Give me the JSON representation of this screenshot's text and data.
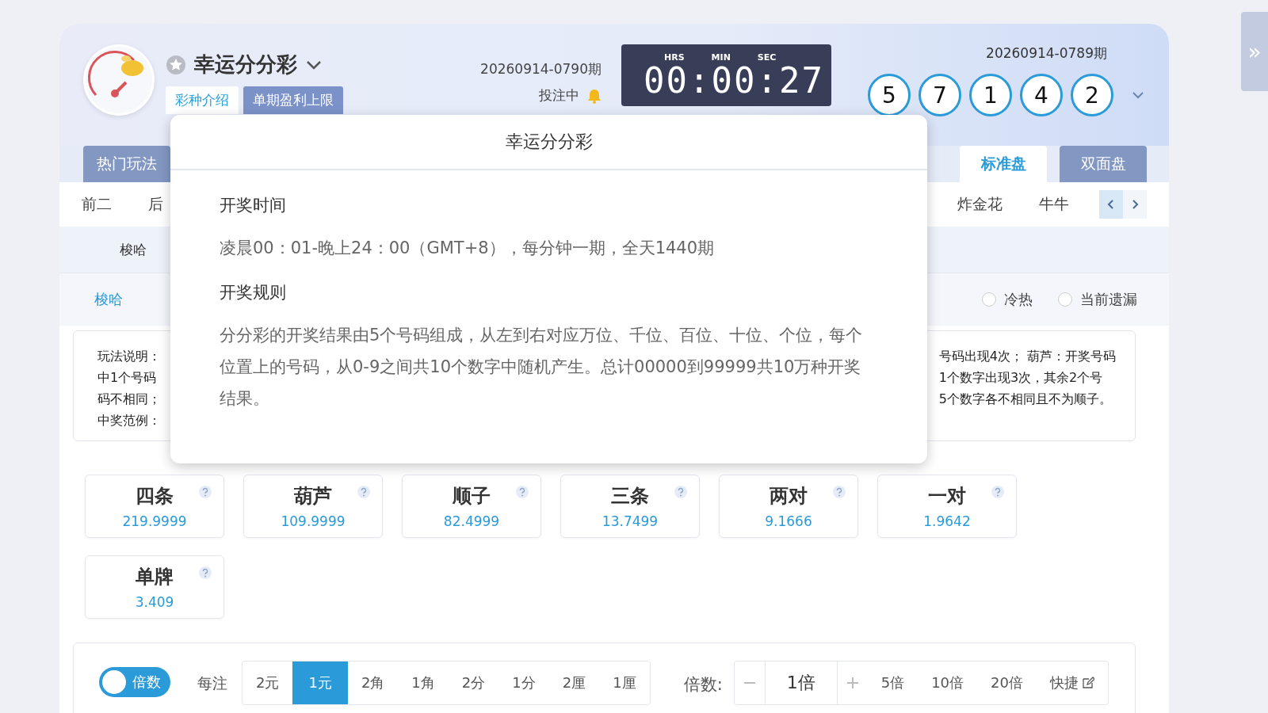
{
  "header": {
    "title": "幸运分分彩",
    "tabs": [
      {
        "label": "彩种介绍",
        "selected": true
      },
      {
        "label": "单期盈利上限",
        "selected": false
      }
    ],
    "current_period": "20260914-0790期",
    "status": "投注中",
    "countdown": {
      "labels": [
        "HRS",
        "MIN",
        "SEC"
      ],
      "time": "00:00:27"
    },
    "last_period": "20260914-0789期",
    "last_numbers": [
      "5",
      "7",
      "1",
      "4",
      "2"
    ]
  },
  "mode_tabs_left": [
    {
      "label": "热门玩法",
      "selected": false
    }
  ],
  "mode_tabs_right": [
    {
      "label": "标准盘",
      "selected": true
    },
    {
      "label": "双面盘",
      "selected": false
    }
  ],
  "play_nav": {
    "left": [
      "前二",
      "后"
    ],
    "right": [
      "炸金花",
      "牛牛"
    ]
  },
  "sub_tabs": [
    "梭哈"
  ],
  "play_tabs": [
    {
      "label": "梭哈",
      "selected": true
    }
  ],
  "options": [
    {
      "label": "冷热",
      "selected": false
    },
    {
      "label": "当前遗漏",
      "selected": false
    }
  ],
  "explanation": {
    "left_lines": [
      "玩法说明：",
      "中1个号码",
      "码不相同；",
      "中奖范例："
    ],
    "right_lines": [
      "号码出现4次；  葫芦：开奖号码",
      "1个数字出现3次，其余2个号",
      "5个数字各不相同且不为顺子。"
    ]
  },
  "odds": [
    {
      "name": "四条",
      "odds": "219.9999"
    },
    {
      "name": "葫芦",
      "odds": "109.9999"
    },
    {
      "name": "顺子",
      "odds": "82.4999"
    },
    {
      "name": "三条",
      "odds": "13.7499"
    },
    {
      "name": "两对",
      "odds": "9.1666"
    },
    {
      "name": "一对",
      "odds": "1.9642"
    },
    {
      "name": "单牌",
      "odds": "3.409"
    }
  ],
  "bet_bar": {
    "toggle": {
      "label": "倍数",
      "on": false
    },
    "unit_label": "每注",
    "units": [
      {
        "label": "2元",
        "selected": false
      },
      {
        "label": "1元",
        "selected": true
      },
      {
        "label": "2角",
        "selected": false
      },
      {
        "label": "1角",
        "selected": false
      },
      {
        "label": "2分",
        "selected": false
      },
      {
        "label": "1分",
        "selected": false
      },
      {
        "label": "2厘",
        "selected": false
      },
      {
        "label": "1厘",
        "selected": false
      }
    ],
    "multiplier_label": "倍数:",
    "multiplier_value": "1倍",
    "presets": [
      "5倍",
      "10倍",
      "20倍"
    ],
    "shortcut": "快捷"
  },
  "popup": {
    "title": "幸运分分彩",
    "sections": [
      {
        "heading": "开奖时间",
        "text": "凌晨00：01-晚上24：00（GMT+8），每分钟一期，全天1440期"
      },
      {
        "heading": "开奖规则",
        "text": "分分彩的开奖结果由5个号码组成，从左到右对应万位、千位、百位、十位、个位，每个位置上的号码，从0-9之间共10个数字中随机产生。总计00000到99999共10万种开奖结果。"
      }
    ]
  },
  "side_tab": "»"
}
